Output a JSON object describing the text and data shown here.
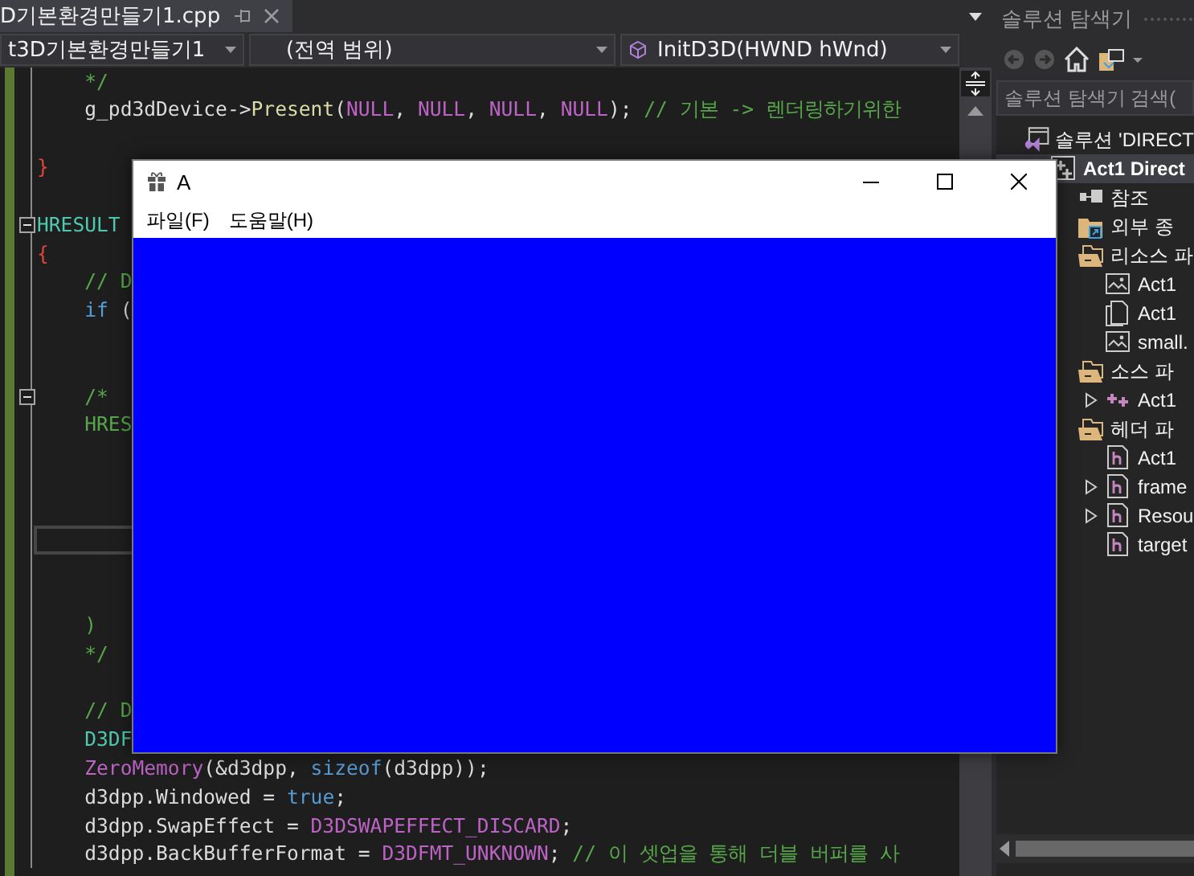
{
  "document_tab": {
    "title": "D기본환경만들기1.cpp"
  },
  "navigation_bar": {
    "project": "t3D기본환경만들기1",
    "scope": "(전역 범위)",
    "function": "InitD3D(HWND hWnd)"
  },
  "editor": {
    "lines": [
      {
        "fold": false,
        "current": false,
        "tokens": [
          {
            "text": "    */",
            "kind": "comment"
          }
        ]
      },
      {
        "fold": false,
        "current": false,
        "tokens": [
          {
            "text": "    g_pd3dDevice->",
            "kind": "plain"
          },
          {
            "text": "Present",
            "kind": "func"
          },
          {
            "text": "(",
            "kind": "plain"
          },
          {
            "text": "NULL",
            "kind": "macro"
          },
          {
            "text": ", ",
            "kind": "plain"
          },
          {
            "text": "NULL",
            "kind": "macro"
          },
          {
            "text": ", ",
            "kind": "plain"
          },
          {
            "text": "NULL",
            "kind": "macro"
          },
          {
            "text": ", ",
            "kind": "plain"
          },
          {
            "text": "NULL",
            "kind": "macro"
          },
          {
            "text": "); ",
            "kind": "plain"
          },
          {
            "text": "// 기본 -> 렌더링하기위한",
            "kind": "comment"
          }
        ]
      },
      {
        "fold": false,
        "current": false
      },
      {
        "fold": false,
        "current": false,
        "tokens": [
          {
            "text": "}",
            "kind": "brace"
          }
        ]
      },
      {
        "fold": false,
        "current": false
      },
      {
        "fold": true,
        "current": false,
        "tokens": [
          {
            "text": "HRESULT",
            "kind": "type"
          }
        ]
      },
      {
        "fold": false,
        "current": false,
        "tokens": [
          {
            "text": "{",
            "kind": "brace"
          }
        ]
      },
      {
        "fold": false,
        "current": false,
        "tokens": [
          {
            "text": "    // D",
            "kind": "comment"
          }
        ]
      },
      {
        "fold": false,
        "current": false,
        "tokens": [
          {
            "text": "    if",
            "kind": "keyword"
          },
          {
            "text": " (",
            "kind": "plain"
          }
        ]
      },
      {
        "fold": false,
        "current": false
      },
      {
        "fold": false,
        "current": false
      },
      {
        "fold": true,
        "current": false,
        "tokens": [
          {
            "text": "    /*",
            "kind": "comment"
          }
        ]
      },
      {
        "fold": false,
        "current": false,
        "tokens": [
          {
            "text": "    HRES",
            "kind": "comment"
          }
        ]
      },
      {
        "fold": false,
        "current": false
      },
      {
        "fold": false,
        "current": false
      },
      {
        "fold": false,
        "current": false
      },
      {
        "fold": false,
        "current": true
      },
      {
        "fold": false,
        "current": false
      },
      {
        "fold": false,
        "current": false
      },
      {
        "fold": false,
        "current": false,
        "tokens": [
          {
            "text": "    )",
            "kind": "comment"
          }
        ]
      },
      {
        "fold": false,
        "current": false,
        "tokens": [
          {
            "text": "    */",
            "kind": "comment"
          }
        ]
      },
      {
        "fold": false,
        "current": false
      },
      {
        "fold": false,
        "current": false,
        "tokens": [
          {
            "text": "    // D",
            "kind": "comment"
          }
        ]
      },
      {
        "fold": false,
        "current": false,
        "tokens": [
          {
            "text": "    D3DF",
            "kind": "type"
          }
        ]
      },
      {
        "fold": false,
        "current": false,
        "tokens": [
          {
            "text": "    ZeroMemory",
            "kind": "macro"
          },
          {
            "text": "(&d3dpp, ",
            "kind": "plain"
          },
          {
            "text": "sizeof",
            "kind": "keyword"
          },
          {
            "text": "(d3dpp));",
            "kind": "plain"
          }
        ]
      },
      {
        "fold": false,
        "current": false,
        "tokens": [
          {
            "text": "    d3dpp.Windowed = ",
            "kind": "plain"
          },
          {
            "text": "true",
            "kind": "keyword"
          },
          {
            "text": ";",
            "kind": "plain"
          }
        ]
      },
      {
        "fold": false,
        "current": false,
        "tokens": [
          {
            "text": "    d3dpp.SwapEffect = ",
            "kind": "plain"
          },
          {
            "text": "D3DSWAPEFFECT_DISCARD",
            "kind": "macro"
          },
          {
            "text": ";",
            "kind": "plain"
          }
        ]
      },
      {
        "fold": false,
        "current": false,
        "tokens": [
          {
            "text": "    d3dpp.BackBufferFormat = ",
            "kind": "plain"
          },
          {
            "text": "D3DFMT_UNKNOWN",
            "kind": "macro"
          },
          {
            "text": "; ",
            "kind": "plain"
          },
          {
            "text": "// 이 셋업을 통해 더블 버퍼를 사",
            "kind": "comment"
          }
        ]
      }
    ]
  },
  "solution_explorer": {
    "title": "솔루션 탐색기",
    "search": {
      "placeholder": "솔루션 탐색기 검색("
    },
    "tree": [
      {
        "label": "솔루션 'DIRECT",
        "kind": "solution",
        "selected": false,
        "collapsed": false,
        "children": [
          {
            "label": "Act1 Direct",
            "kind": "project",
            "selected": true,
            "collapsed": false,
            "children": [
              {
                "label": "참조",
                "kind": "references",
                "selected": false,
                "collapsed": false
              },
              {
                "label": "외부 종",
                "kind": "external",
                "selected": false,
                "collapsed": false
              },
              {
                "label": "리소스 파",
                "kind": "folder",
                "selected": false,
                "collapsed": false,
                "children": [
                  {
                    "label": "Act1",
                    "kind": "image",
                    "selected": false,
                    "collapsed": false
                  },
                  {
                    "label": "Act1",
                    "kind": "file",
                    "selected": false,
                    "collapsed": false
                  },
                  {
                    "label": "small.",
                    "kind": "image",
                    "selected": false,
                    "collapsed": false
                  }
                ]
              },
              {
                "label": "소스 파",
                "kind": "folder",
                "selected": false,
                "collapsed": false,
                "children": [
                  {
                    "label": "Act1",
                    "kind": "cpp",
                    "selected": false,
                    "collapsed": true
                  }
                ]
              },
              {
                "label": "헤더 파",
                "kind": "folder",
                "selected": false,
                "collapsed": false,
                "children": [
                  {
                    "label": "Act1",
                    "kind": "header",
                    "selected": false,
                    "collapsed": false
                  },
                  {
                    "label": "frame",
                    "kind": "header",
                    "selected": false,
                    "collapsed": true
                  },
                  {
                    "label": "Resou",
                    "kind": "header",
                    "selected": false,
                    "collapsed": true
                  },
                  {
                    "label": "target",
                    "kind": "header",
                    "selected": false,
                    "collapsed": false
                  }
                ]
              }
            ]
          }
        ]
      }
    ]
  },
  "app_window": {
    "title": "A",
    "menu": [
      "파일(F)",
      "도움말(H)"
    ]
  }
}
